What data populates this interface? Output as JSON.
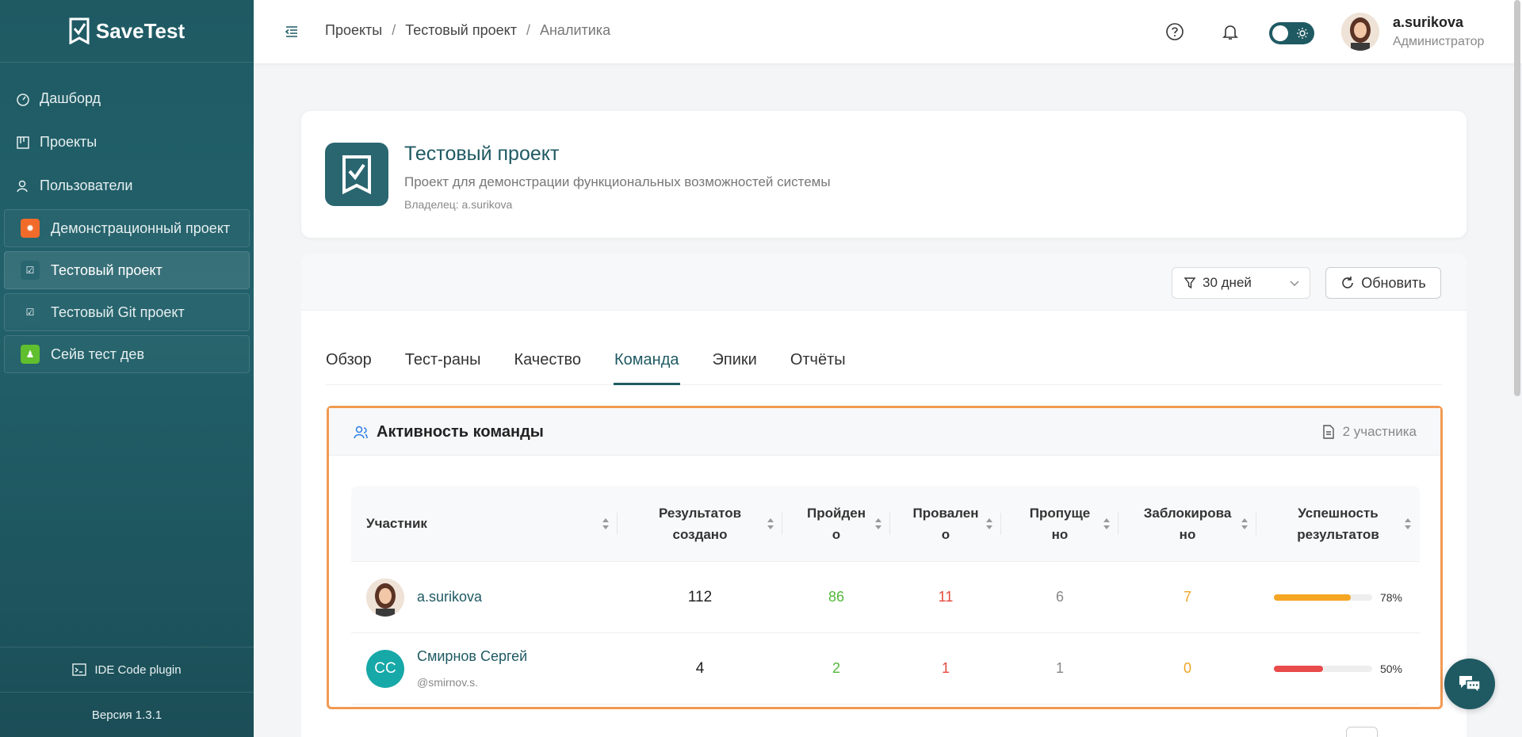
{
  "app": {
    "name": "SaveTest",
    "version": "Версия 1.3.1",
    "ide_plugin": "IDE Code plugin"
  },
  "nav": [
    {
      "label": "Дашборд",
      "icon": "dashboard-icon"
    },
    {
      "label": "Проекты",
      "icon": "projects-icon"
    },
    {
      "label": "Пользователи",
      "icon": "users-icon"
    }
  ],
  "projects": [
    {
      "label": "Демонстрационный проект",
      "color": "#f26b2a",
      "active": false
    },
    {
      "label": "Тестовый проект",
      "color": "#2a6670",
      "active": true
    },
    {
      "label": "Тестовый Git проект",
      "color": "#2a6670",
      "active": false
    },
    {
      "label": "Сейв тест дев",
      "color": "#5fbf2e",
      "active": false
    }
  ],
  "breadcrumb": {
    "root": "Проекты",
    "project": "Тестовый проект",
    "current": "Аналитика",
    "sep": "/"
  },
  "user": {
    "name": "a.surikova",
    "role": "Администратор"
  },
  "project": {
    "title": "Тестовый проект",
    "description": "Проект для демонстрации функциональных возможностей системы",
    "owner": "Владелец: a.surikova"
  },
  "filters": {
    "period": "30 дней",
    "refresh": "Обновить"
  },
  "tabs": [
    "Обзор",
    "Тест-раны",
    "Качество",
    "Команда",
    "Эпики",
    "Отчёты"
  ],
  "active_tab": "Команда",
  "team": {
    "title": "Активность команды",
    "count": "2 участника",
    "columns": [
      {
        "l1": "Участник",
        "l2": ""
      },
      {
        "l1": "Результатов",
        "l2": "создано"
      },
      {
        "l1": "Пройден",
        "l2": "о"
      },
      {
        "l1": "Провален",
        "l2": "о"
      },
      {
        "l1": "Пропуще",
        "l2": "но"
      },
      {
        "l1": "Заблокирова",
        "l2": "но"
      },
      {
        "l1": "Успешность",
        "l2": "результатов"
      }
    ],
    "rows": [
      {
        "name": "a.surikova",
        "login": "",
        "initials": "",
        "created": "112",
        "passed": "86",
        "failed": "11",
        "skipped": "6",
        "blocked": "7",
        "success_pct": "78%",
        "success_value": 78,
        "bar_color": "#f5a623"
      },
      {
        "name": "Смирнов Сергей",
        "login": "@smirnov.s.",
        "initials": "СС",
        "created": "4",
        "passed": "2",
        "failed": "1",
        "skipped": "1",
        "blocked": "0",
        "success_pct": "50%",
        "success_value": 50,
        "bar_color": "#e94a4a"
      }
    ]
  },
  "colors": {
    "primary": "#1f5a63",
    "highlight": "#f19a52",
    "success": "#52b83a",
    "danger": "#e5483d",
    "warning": "#f0a524"
  }
}
